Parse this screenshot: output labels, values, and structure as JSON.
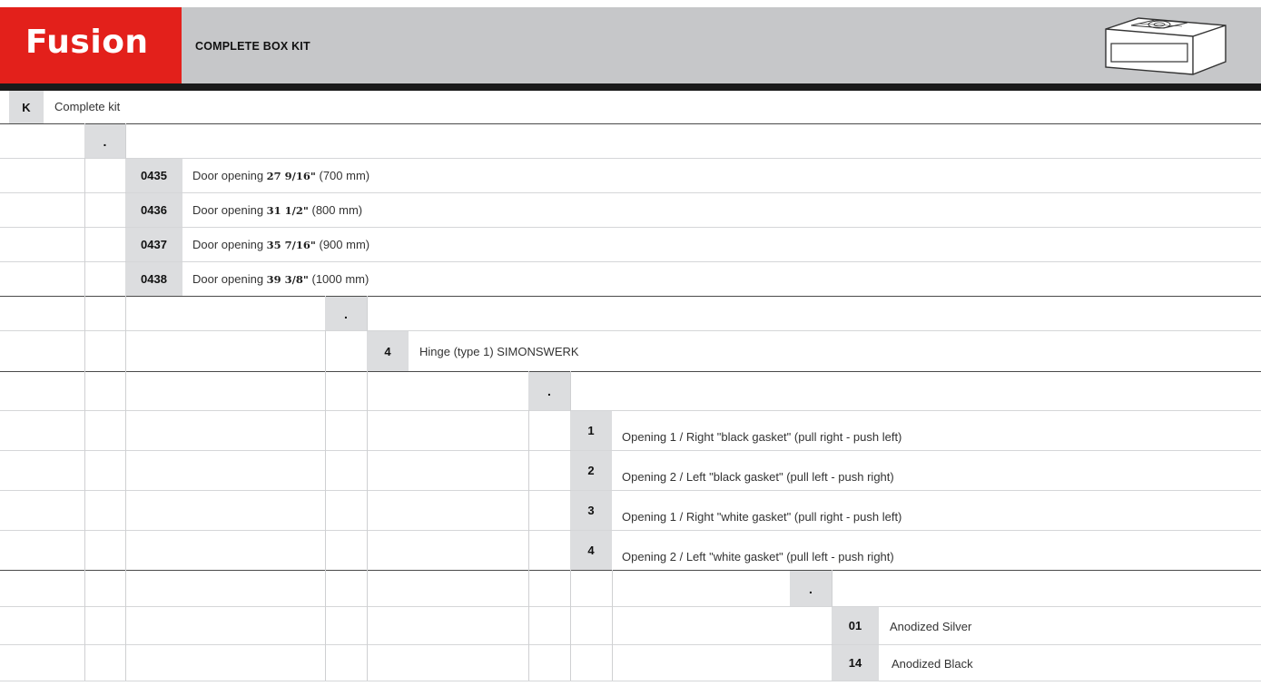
{
  "header": {
    "brand": "Fusion",
    "title": "COMPLETE BOX KIT",
    "colors": {
      "brand_red": "#e3201b",
      "header_gray": "#c6c7c9",
      "code_cell": "#dcdddf"
    },
    "illustration_icon": "box-kit-icon"
  },
  "kit": {
    "code": "K",
    "label": "Complete kit"
  },
  "separator": ".",
  "door_openings": [
    {
      "code": "0435",
      "prefix": "Door opening ",
      "inches": "27 9/16\"",
      "mm": " (700 mm)"
    },
    {
      "code": "0436",
      "prefix": "Door opening  ",
      "inches": "31 1/2\"",
      "mm": " (800 mm)"
    },
    {
      "code": "0437",
      "prefix": "Door opening  ",
      "inches": "35 7/16\"",
      "mm": " (900 mm)"
    },
    {
      "code": "0438",
      "prefix": "Door opening ",
      "inches": "39 3/8\"",
      "mm": " (1000 mm)"
    }
  ],
  "hinge": {
    "code": "4",
    "label": "Hinge (type 1)  SIMONSWERK"
  },
  "openings": [
    {
      "code": "1",
      "label": "Opening 1 / Right \"black gasket\" (pull right - push left)"
    },
    {
      "code": "2",
      "label": "Opening 2 / Left \"black gasket\" (pull left - push right)"
    },
    {
      "code": "3",
      "label": "Opening 1 / Right \"white gasket\" (pull right - push left)"
    },
    {
      "code": "4",
      "label": "Opening 2 / Left \"white gasket\" (pull left - push right)"
    }
  ],
  "finishes": [
    {
      "code": "01",
      "label": "Anodized Silver"
    },
    {
      "code": "14",
      "label": "Anodized Black"
    }
  ]
}
